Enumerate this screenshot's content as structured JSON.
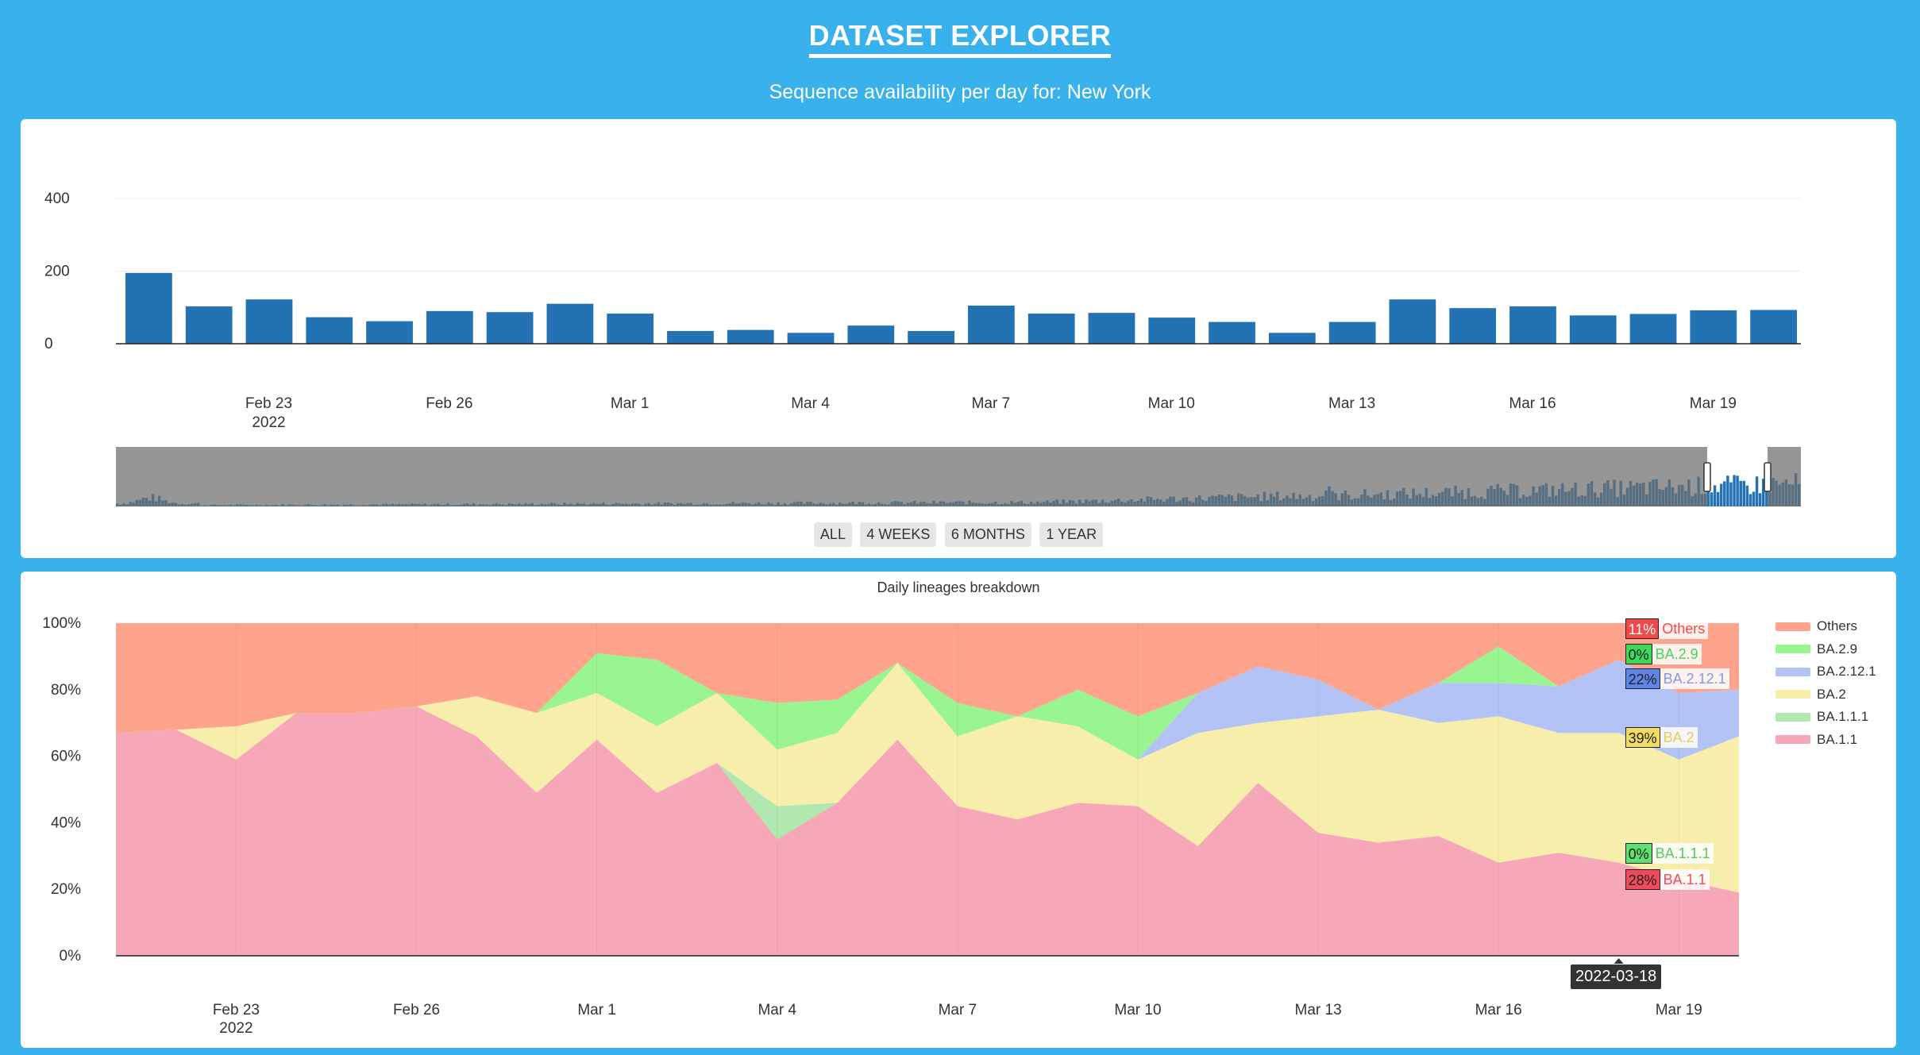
{
  "header": {
    "title": "DATASET EXPLORER",
    "subtitle": "Sequence availability per day for: New York"
  },
  "availability": {
    "range_buttons": [
      "ALL",
      "4 WEEKS",
      "6 MONTHS",
      "1 YEAR"
    ]
  },
  "chart_data": [
    {
      "type": "bar",
      "categories": [
        "2022-02-21",
        "2022-02-22",
        "2022-02-23",
        "2022-02-24",
        "2022-02-25",
        "2022-02-26",
        "2022-02-27",
        "2022-02-28",
        "2022-03-01",
        "2022-03-02",
        "2022-03-03",
        "2022-03-04",
        "2022-03-05",
        "2022-03-06",
        "2022-03-07",
        "2022-03-08",
        "2022-03-09",
        "2022-03-10",
        "2022-03-11",
        "2022-03-12",
        "2022-03-13",
        "2022-03-14",
        "2022-03-15",
        "2022-03-16",
        "2022-03-17",
        "2022-03-18",
        "2022-03-19",
        "2022-03-20"
      ],
      "values": [
        195,
        103,
        122,
        73,
        62,
        90,
        87,
        110,
        83,
        35,
        38,
        30,
        50,
        35,
        105,
        83,
        85,
        72,
        60,
        30,
        60,
        122,
        98,
        103,
        78,
        82,
        92,
        93
      ],
      "yticks": [
        "0",
        "200",
        "400"
      ],
      "ylim": [
        0,
        400
      ],
      "xticks": [
        {
          "date": "2022-02-23",
          "label": "Feb 23",
          "sub": "2022"
        },
        {
          "date": "2022-02-26",
          "label": "Feb 26"
        },
        {
          "date": "2022-03-01",
          "label": "Mar 1"
        },
        {
          "date": "2022-03-04",
          "label": "Mar 4"
        },
        {
          "date": "2022-03-07",
          "label": "Mar 7"
        },
        {
          "date": "2022-03-10",
          "label": "Mar 10"
        },
        {
          "date": "2022-03-13",
          "label": "Mar 13"
        },
        {
          "date": "2022-03-16",
          "label": "Mar 16"
        },
        {
          "date": "2022-03-19",
          "label": "Mar 19"
        }
      ],
      "color": "#2373b4",
      "grid": true
    },
    {
      "type": "area",
      "stacked": "percent",
      "title": "Daily lineages breakdown",
      "x": [
        "2022-02-21",
        "2022-02-22",
        "2022-02-23",
        "2022-02-24",
        "2022-02-25",
        "2022-02-26",
        "2022-02-27",
        "2022-02-28",
        "2022-03-01",
        "2022-03-02",
        "2022-03-03",
        "2022-03-04",
        "2022-03-05",
        "2022-03-06",
        "2022-03-07",
        "2022-03-08",
        "2022-03-09",
        "2022-03-10",
        "2022-03-11",
        "2022-03-12",
        "2022-03-13",
        "2022-03-14",
        "2022-03-15",
        "2022-03-16",
        "2022-03-17",
        "2022-03-18",
        "2022-03-19",
        "2022-03-20"
      ],
      "yticks": [
        "0%",
        "20%",
        "40%",
        "60%",
        "80%",
        "100%"
      ],
      "ylim": [
        0,
        100
      ],
      "legend_position": "right",
      "series": [
        {
          "name": "BA.1.1",
          "color": "#f6a8b8",
          "values": [
            67,
            68,
            59,
            73,
            73,
            75,
            66,
            49,
            65,
            49,
            58,
            35,
            46,
            65,
            45,
            41,
            46,
            45,
            33,
            52,
            37,
            34,
            36,
            28,
            31,
            28,
            23,
            19
          ]
        },
        {
          "name": "BA.1.1.1",
          "color": "#b0e8b0",
          "values": [
            0,
            0,
            0,
            0,
            0,
            0,
            0,
            0,
            0,
            0,
            0,
            10,
            0,
            0,
            0,
            0,
            0,
            0,
            0,
            0,
            0,
            0,
            0,
            0,
            0,
            0,
            0,
            0
          ]
        },
        {
          "name": "BA.2",
          "color": "#f8eeac",
          "values": [
            0,
            0,
            10,
            0,
            0,
            0,
            12,
            24,
            14,
            20,
            21,
            17,
            21,
            23,
            21,
            31,
            23,
            14,
            34,
            18,
            35,
            40,
            34,
            44,
            36,
            39,
            36,
            47
          ]
        },
        {
          "name": "BA.2.12.1",
          "color": "#b3c3f5",
          "values": [
            0,
            0,
            0,
            0,
            0,
            0,
            0,
            0,
            0,
            0,
            0,
            0,
            0,
            0,
            0,
            0,
            0,
            0,
            12,
            17,
            11,
            0,
            12,
            10,
            14,
            22,
            20,
            14
          ]
        },
        {
          "name": "BA.2.9",
          "color": "#98f590",
          "values": [
            0,
            0,
            0,
            0,
            0,
            0,
            0,
            0,
            12,
            20,
            0,
            14,
            10,
            0,
            10,
            0,
            11,
            13,
            0,
            0,
            0,
            0,
            0,
            11,
            0,
            0,
            0,
            0
          ]
        },
        {
          "name": "Others",
          "color": "#ffa48c",
          "values": [
            33,
            32,
            31,
            27,
            27,
            25,
            22,
            27,
            9,
            11,
            21,
            24,
            23,
            12,
            24,
            28,
            20,
            28,
            21,
            13,
            17,
            26,
            18,
            7,
            19,
            11,
            21,
            20
          ]
        }
      ],
      "xticks": [
        {
          "date": "2022-02-23",
          "label": "Feb 23",
          "sub": "2022"
        },
        {
          "date": "2022-02-26",
          "label": "Feb 26"
        },
        {
          "date": "2022-03-01",
          "label": "Mar 1"
        },
        {
          "date": "2022-03-04",
          "label": "Mar 4"
        },
        {
          "date": "2022-03-07",
          "label": "Mar 7"
        },
        {
          "date": "2022-03-10",
          "label": "Mar 10"
        },
        {
          "date": "2022-03-13",
          "label": "Mar 13"
        },
        {
          "date": "2022-03-16",
          "label": "Mar 16"
        },
        {
          "date": "2022-03-19",
          "label": "Mar 19"
        }
      ],
      "hover": {
        "date": "2022-03-18",
        "labels": [
          {
            "series": "Others",
            "pct": "11%",
            "bg": "#f04a4a",
            "fg": "#f04a4a",
            "boxfg": "#ffffff"
          },
          {
            "series": "BA.2.9",
            "pct": "0%",
            "bg": "#3ed85b",
            "fg": "#3ed85b",
            "boxfg": "#222222"
          },
          {
            "series": "BA.2.12.1",
            "pct": "22%",
            "bg": "#5f86e6",
            "fg": "#7f9be8",
            "boxfg": "#222222"
          },
          {
            "series": "BA.2",
            "pct": "39%",
            "bg": "#f3dc63",
            "fg": "#e8cd4f",
            "boxfg": "#222222"
          },
          {
            "series": "BA.1.1.1",
            "pct": "0%",
            "bg": "#5fe070",
            "fg": "#4fcc5f",
            "boxfg": "#222222"
          },
          {
            "series": "BA.1.1",
            "pct": "28%",
            "bg": "#f04a5e",
            "fg": "#f04a5e",
            "boxfg": "#222222"
          }
        ]
      }
    }
  ]
}
